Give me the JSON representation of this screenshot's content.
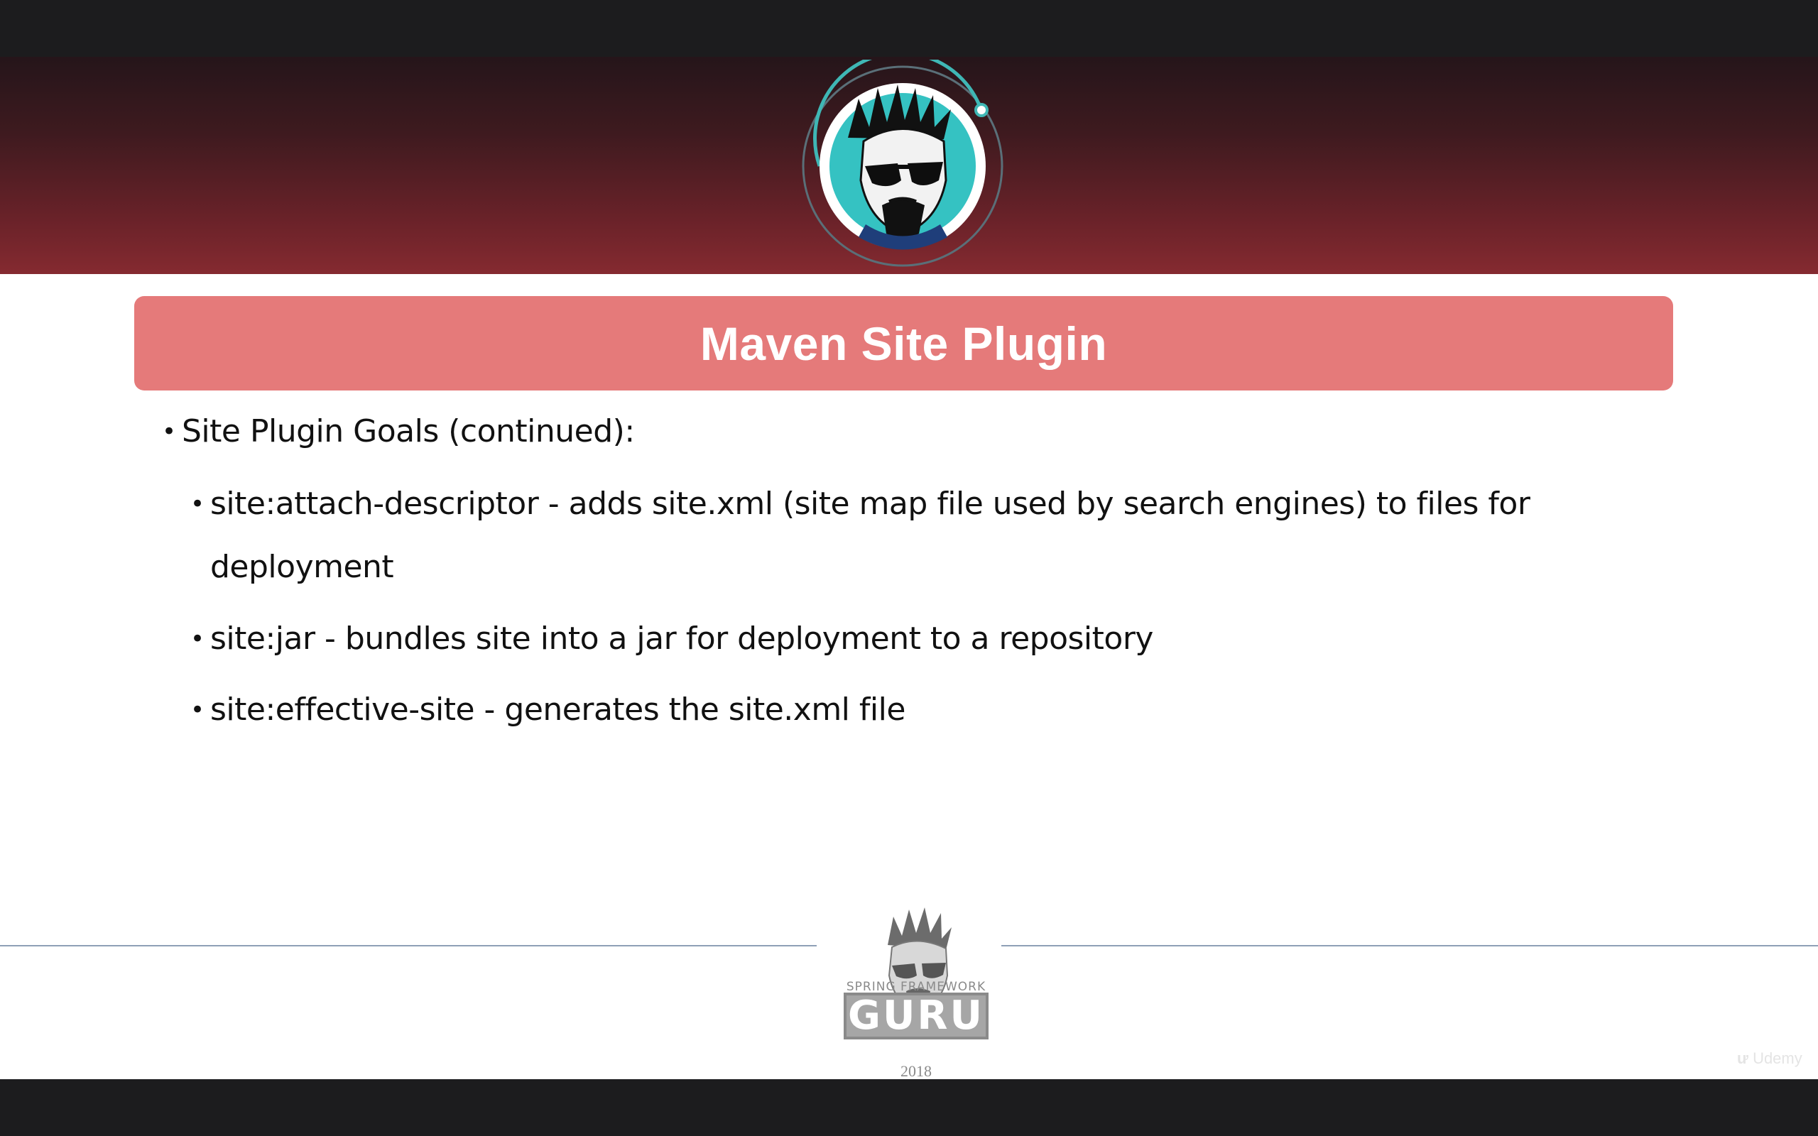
{
  "slide": {
    "title": "Maven Site Plugin",
    "bullets": [
      {
        "level": 1,
        "text": "Site Plugin Goals (continued):"
      },
      {
        "level": 2,
        "text": "site:attach-descriptor - adds site.xml (site map file used by search engines) to files for"
      },
      {
        "level": 2,
        "text": "deployment",
        "continuation": true
      },
      {
        "level": 2,
        "text": "site:jar - bundles site into a jar for deployment to a repository"
      },
      {
        "level": 2,
        "text": "site:effective-site - generates the site.xml file"
      }
    ],
    "footer": {
      "logo_top": "SPRING FRAMEWORK",
      "logo_main": "GURU",
      "year": "2018"
    },
    "watermark": "Udemy"
  },
  "colors": {
    "title_bar": "#e57a7a",
    "header_dark": "#25151a",
    "header_red": "#852a30",
    "letterbox": "#1c1c1e",
    "footer_line": "#8fa0b6",
    "avatar_ring": "#3fb7b5"
  },
  "icons": {
    "header_avatar": "guru-avatar-icon",
    "footer_logo": "spring-framework-guru-logo"
  }
}
